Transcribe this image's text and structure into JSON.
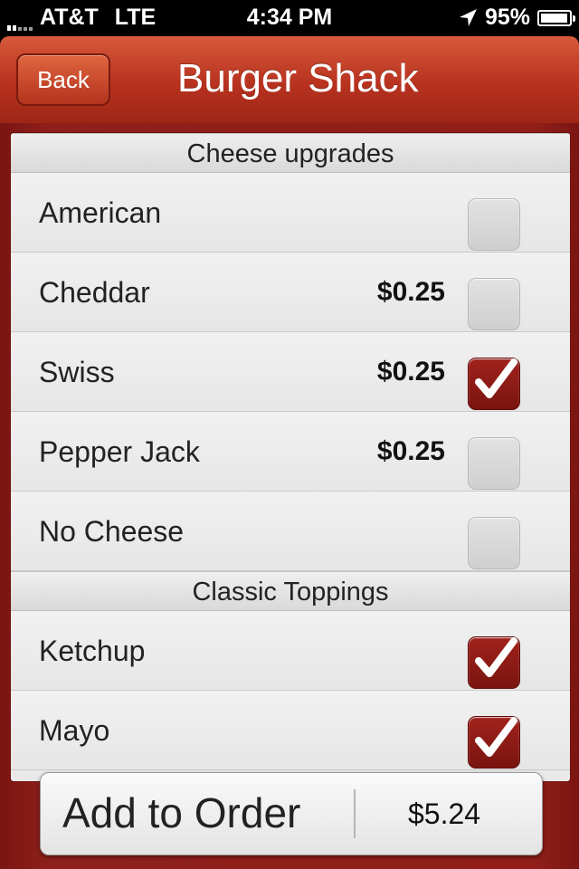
{
  "status_bar": {
    "carrier": "AT&T",
    "network": "LTE",
    "time": "4:34 PM",
    "battery": "95%",
    "battery_level": 0.95,
    "icons": [
      "signal-bars-icon",
      "location-arrow-icon",
      "battery-icon"
    ]
  },
  "nav": {
    "back_label": "Back",
    "title": "Burger Shack"
  },
  "sections": [
    {
      "header": "Cheese upgrades",
      "rows": [
        {
          "label": "American",
          "price": "",
          "checked": false
        },
        {
          "label": "Cheddar",
          "price": "$0.25",
          "checked": false
        },
        {
          "label": "Swiss",
          "price": "$0.25",
          "checked": true
        },
        {
          "label": "Pepper Jack",
          "price": "$0.25",
          "checked": false
        },
        {
          "label": "No Cheese",
          "price": "",
          "checked": false
        }
      ]
    },
    {
      "header": "Classic Toppings",
      "rows": [
        {
          "label": "Ketchup",
          "price": "",
          "checked": true
        },
        {
          "label": "Mayo",
          "price": "",
          "checked": true
        }
      ]
    }
  ],
  "order": {
    "label": "Add to Order",
    "total": "$5.24"
  },
  "colors": {
    "nav_red": "#b8321f",
    "backdrop_red": "#8e1f1a",
    "check_red": "#8f1a15"
  }
}
